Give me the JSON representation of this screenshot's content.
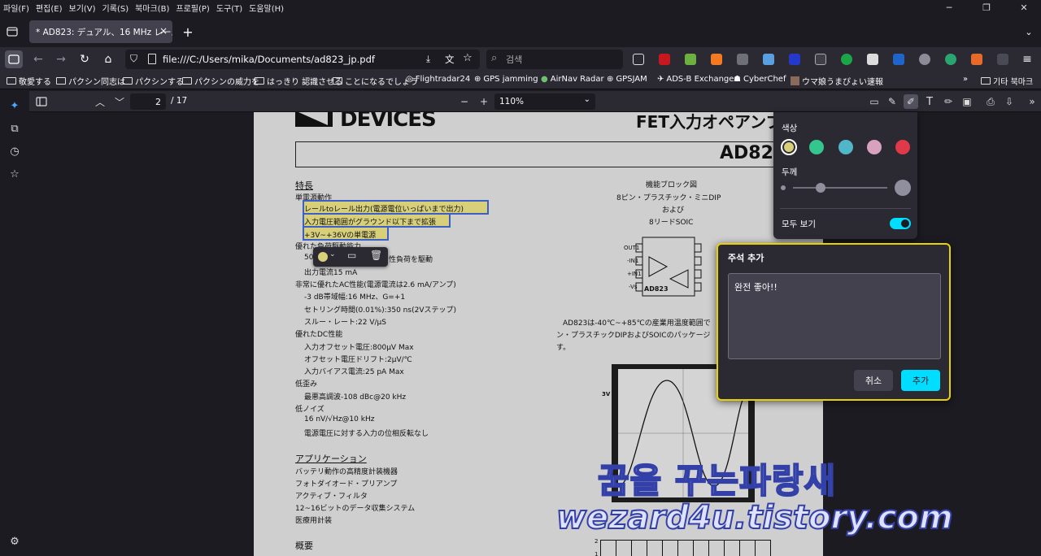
{
  "menu": [
    "파일(F)",
    "편집(E)",
    "보기(V)",
    "기록(S)",
    "북마크(B)",
    "프로필(P)",
    "도구(T)",
    "도움말(H)"
  ],
  "tab": {
    "title": "* AD823: デュアル、16 MHz レール to レ",
    "close": "×",
    "new": "+"
  },
  "url": "file:///C:/Users/mika/Documents/ad823_jp.pdf",
  "search_placeholder": "검색",
  "bookmarks": [
    "敬愛する",
    "パクシン同志は",
    "パクシンする",
    "パクシンの威力を",
    "はっきり 認識させる",
    "ことになるでしょう",
    "Flightradar24",
    "GPS jamming",
    "AirNav Radar",
    "GPSJAM",
    "ADS-B Exchange",
    "CyberChef",
    "ウマ娘うまぴょい速報"
  ],
  "bookmarks_other": "기타 북마크",
  "pdf": {
    "page_current": "2",
    "page_total": "/ 17",
    "zoom": "110%"
  },
  "page": {
    "logo": "DEVICES",
    "header_title": "FET入力オペアンプ",
    "part": "AD823",
    "features_heading": "特長",
    "lines": [
      "単電源動作",
      "レールtoレール出力(電源電位いっぱいまで出力)",
      "入力電圧範囲がグラウンド以下まで拡張",
      "+3V~+36Vの単電源",
      "優れた負荷駆動能力",
      "500",
      "性負荷を駆動",
      "出力電流15 mA",
      "非常に優れたAC性能(電源電流は2.6 mA/アンプ)",
      "-3 dB帯域幅:16 MHz、G=+1",
      "セトリング時間(0.01%):350 ns(2Vステップ)",
      "スルー・レート:22 V/μS",
      "優れたDC性能",
      "入力オフセット電圧:800μV Max",
      "オフセット電圧ドリフト:2μV/℃",
      "入力バイアス電流:25 pA Max",
      "低歪み",
      "最悪高調波-108 dBc@20 kHz",
      "低ノイズ",
      "16 nV/√Hz@10 kHz",
      "電源電圧に対する入力の位相反転なし"
    ],
    "app_heading": "アプリケーション",
    "apps": [
      "バッテリ動作の高精度計装機器",
      "フォトダイオード・プリアンプ",
      "アクティブ・フィルタ",
      "12~16ビットのデータ収集システム",
      "医療用計装"
    ],
    "overview_heading": "概要",
    "block_title": "機能ブロック図",
    "block_sub1": "8ピン・プラスチック・ミニDIP",
    "block_sub2": "および",
    "block_sub3": "8リードSOIC",
    "pins_left": [
      "OUT1",
      "-IN1",
      "+IN1",
      "-Vs"
    ],
    "pins_right": [
      "+V",
      "OUT",
      "-IN",
      "+IN"
    ],
    "chip_label": "AD823",
    "desc1": "AD823は-40℃~+85℃の産業用温度範囲で",
    "desc2": "ン・プラスチックDIPおよびSOICのパッケージ",
    "desc3": "す。",
    "scope_label": "3V",
    "axis_2": "2",
    "axis_1": "1"
  },
  "color_popup": {
    "color_label": "색상",
    "thickness_label": "두께",
    "show_all_label": "모두 보기",
    "colors": [
      "#d7cf7a",
      "#35c58e",
      "#4fb7c7",
      "#d8a2bf",
      "#e0394a"
    ]
  },
  "annotation": {
    "title": "주석 추가",
    "text": "완전 좋아!!",
    "cancel": "취소",
    "add": "추가"
  },
  "watermark": {
    "line1": "꿈을 꾸는파랑새",
    "line2": "wezard4u.tistory.com"
  }
}
